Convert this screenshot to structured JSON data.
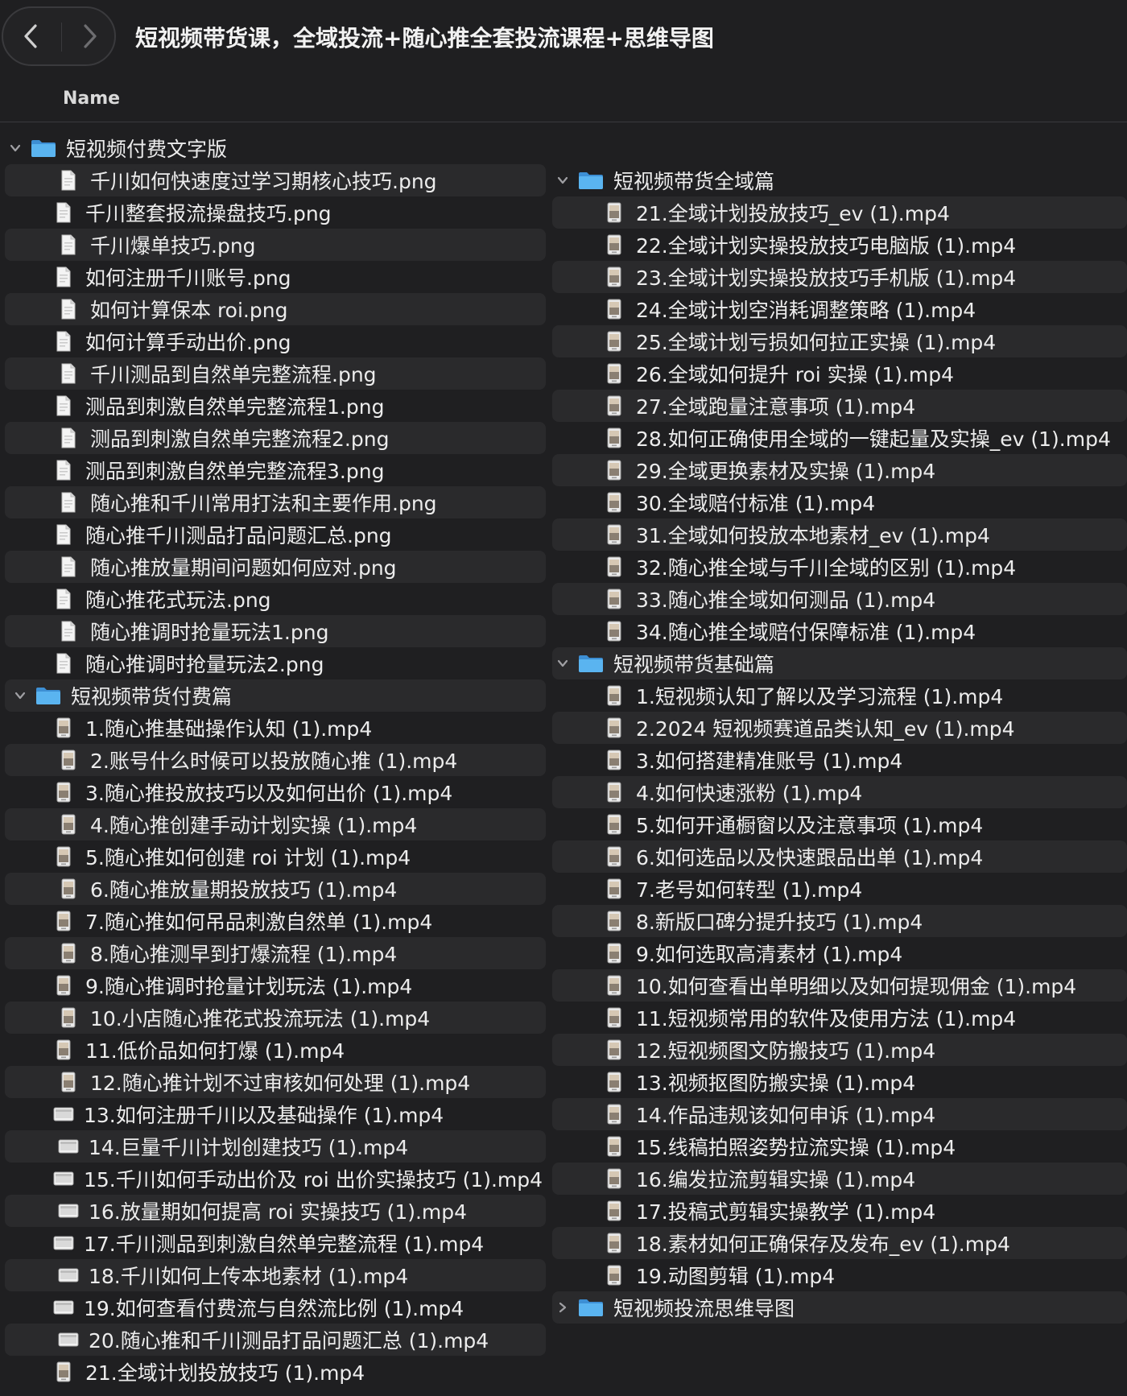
{
  "window": {
    "title": "短视频带货课，全域投流+随心推全套投流课程+思维导图",
    "column_header": "Name"
  },
  "left": [
    {
      "type": "folder",
      "label": "短视频付费文字版",
      "expanded": true
    },
    {
      "type": "png",
      "label": "千川如何快速度过学习期核心技巧.png"
    },
    {
      "type": "png",
      "label": "千川整套报流操盘技巧.png"
    },
    {
      "type": "png",
      "label": "千川爆单技巧.png"
    },
    {
      "type": "png",
      "label": "如何注册千川账号.png"
    },
    {
      "type": "png",
      "label": "如何计算保本 roi.png"
    },
    {
      "type": "png",
      "label": "如何计算手动出价.png"
    },
    {
      "type": "png",
      "label": "千川测品到自然单完整流程.png"
    },
    {
      "type": "png",
      "label": "测品到刺激自然单完整流程1.png"
    },
    {
      "type": "png",
      "label": "测品到刺激自然单完整流程2.png"
    },
    {
      "type": "png",
      "label": "测品到刺激自然单完整流程3.png"
    },
    {
      "type": "png",
      "label": "随心推和千川常用打法和主要作用.png"
    },
    {
      "type": "png",
      "label": "随心推千川测品打品问题汇总.png"
    },
    {
      "type": "png",
      "label": "随心推放量期间问题如何应对.png"
    },
    {
      "type": "png",
      "label": "随心推花式玩法.png"
    },
    {
      "type": "png",
      "label": "随心推调时抢量玩法1.png"
    },
    {
      "type": "png",
      "label": "随心推调时抢量玩法2.png"
    },
    {
      "type": "folder",
      "label": "短视频带货付费篇",
      "expanded": true
    },
    {
      "type": "mp4",
      "label": "1.随心推基础操作认知 (1).mp4"
    },
    {
      "type": "mp4",
      "label": "2.账号什么时候可以投放随心推 (1).mp4"
    },
    {
      "type": "mp4",
      "label": "3.随心推投放技巧以及如何出价 (1).mp4"
    },
    {
      "type": "mp4",
      "label": "4.随心推创建手动计划实操 (1).mp4"
    },
    {
      "type": "mp4",
      "label": "5.随心推如何创建 roi 计划 (1).mp4"
    },
    {
      "type": "mp4",
      "label": "6.随心推放量期投放技巧 (1).mp4"
    },
    {
      "type": "mp4",
      "label": "7.随心推如何吊品刺激自然单 (1).mp4"
    },
    {
      "type": "mp4",
      "label": "8.随心推测早到打爆流程 (1).mp4"
    },
    {
      "type": "mp4",
      "label": "9.随心推调时抢量计划玩法 (1).mp4"
    },
    {
      "type": "mp4",
      "label": "10.小店随心推花式投流玩法 (1).mp4"
    },
    {
      "type": "mp4",
      "label": "11.低价品如何打爆 (1).mp4"
    },
    {
      "type": "mp4",
      "label": "12.随心推计划不过审核如何处理 (1).mp4"
    },
    {
      "type": "mp4w",
      "label": "13.如何注册千川以及基础操作 (1).mp4"
    },
    {
      "type": "mp4w",
      "label": "14.巨量千川计划创建技巧 (1).mp4"
    },
    {
      "type": "mp4w",
      "label": "15.千川如何手动出价及 roi 出价实操技巧 (1).mp4"
    },
    {
      "type": "mp4w",
      "label": "16.放量期如何提高 roi 实操技巧 (1).mp4"
    },
    {
      "type": "mp4w",
      "label": "17.千川测品到刺激自然单完整流程 (1).mp4"
    },
    {
      "type": "mp4w",
      "label": "18.千川如何上传本地素材 (1).mp4"
    },
    {
      "type": "mp4w",
      "label": "19.如何查看付费流与自然流比例 (1).mp4"
    },
    {
      "type": "mp4w",
      "label": "20.随心推和千川测品打品问题汇总 (1).mp4"
    },
    {
      "type": "mp4",
      "label": "21.全域计划投放技巧 (1).mp4"
    }
  ],
  "right": [
    {
      "type": "folder",
      "label": "短视频带货全域篇",
      "expanded": true
    },
    {
      "type": "mp4",
      "label": "21.全域计划投放技巧_ev (1).mp4"
    },
    {
      "type": "mp4",
      "label": "22.全域计划实操投放技巧电脑版 (1).mp4"
    },
    {
      "type": "mp4",
      "label": "23.全域计划实操投放技巧手机版 (1).mp4"
    },
    {
      "type": "mp4",
      "label": "24.全域计划空消耗调整策略 (1).mp4"
    },
    {
      "type": "mp4",
      "label": "25.全域计划亏损如何拉正实操 (1).mp4"
    },
    {
      "type": "mp4",
      "label": "26.全域如何提升 roi 实操 (1).mp4"
    },
    {
      "type": "mp4",
      "label": "27.全域跑量注意事项 (1).mp4"
    },
    {
      "type": "mp4",
      "label": "28.如何正确使用全域的一键起量及实操_ev (1).mp4"
    },
    {
      "type": "mp4",
      "label": "29.全域更换素材及实操 (1).mp4"
    },
    {
      "type": "mp4",
      "label": "30.全域赔付标准 (1).mp4"
    },
    {
      "type": "mp4",
      "label": "31.全域如何投放本地素材_ev (1).mp4"
    },
    {
      "type": "mp4",
      "label": "32.随心推全域与千川全域的区别 (1).mp4"
    },
    {
      "type": "mp4",
      "label": "33.随心推全域如何测品 (1).mp4"
    },
    {
      "type": "mp4",
      "label": "34.随心推全域赔付保障标准 (1).mp4"
    },
    {
      "type": "folder",
      "label": "短视频带货基础篇",
      "expanded": true
    },
    {
      "type": "mp4",
      "label": "1.短视频认知了解以及学习流程 (1).mp4"
    },
    {
      "type": "mp4",
      "label": "2.2024 短视频赛道品类认知_ev (1).mp4"
    },
    {
      "type": "mp4",
      "label": "3.如何搭建精准账号 (1).mp4"
    },
    {
      "type": "mp4",
      "label": "4.如何快速涨粉 (1).mp4"
    },
    {
      "type": "mp4",
      "label": "5.如何开通橱窗以及注意事项 (1).mp4"
    },
    {
      "type": "mp4",
      "label": "6.如何选品以及快速跟品出单 (1).mp4"
    },
    {
      "type": "mp4",
      "label": "7.老号如何转型 (1).mp4"
    },
    {
      "type": "mp4",
      "label": "8.新版口碑分提升技巧 (1).mp4"
    },
    {
      "type": "mp4",
      "label": "9.如何选取高清素材 (1).mp4"
    },
    {
      "type": "mp4",
      "label": "10.如何查看出单明细以及如何提现佣金 (1).mp4"
    },
    {
      "type": "mp4",
      "label": "11.短视频常用的软件及使用方法 (1).mp4"
    },
    {
      "type": "mp4",
      "label": "12.短视频图文防搬技巧 (1).mp4"
    },
    {
      "type": "mp4",
      "label": "13.视频抠图防搬实操 (1).mp4"
    },
    {
      "type": "mp4",
      "label": "14.作品违规该如何申诉 (1).mp4"
    },
    {
      "type": "mp4",
      "label": "15.线稿拍照姿势拉流实操 (1).mp4"
    },
    {
      "type": "mp4",
      "label": "16.编发拉流剪辑实操 (1).mp4"
    },
    {
      "type": "mp4",
      "label": "17.投稿式剪辑实操教学 (1).mp4"
    },
    {
      "type": "mp4",
      "label": "18.素材如何正确保存及发布_ev (1).mp4"
    },
    {
      "type": "mp4",
      "label": "19.动图剪辑 (1).mp4"
    },
    {
      "type": "folder",
      "label": "短视频投流思维导图",
      "expanded": false
    }
  ],
  "colors": {
    "background": "#1f1f21",
    "row_stripe": "#2a2a2c",
    "folder": "#5ab4f0",
    "text": "#ececec"
  },
  "icons": {
    "back": "chevron-left-icon",
    "forward": "chevron-right-icon",
    "folder": "folder-icon",
    "image_file": "image-file-icon",
    "video_file": "video-file-icon"
  }
}
